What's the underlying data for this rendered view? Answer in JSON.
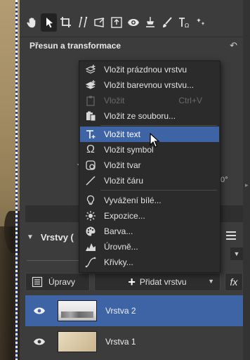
{
  "panel": {
    "section_title": "Přesun a transformace",
    "stub_a": "J",
    "stub_b": "0°"
  },
  "toolbar": {
    "tools": [
      "hand-icon",
      "pointer-icon",
      "crop-icon",
      "straighten-icon",
      "perspective-icon",
      "frame-icon",
      "eye-icon",
      "clone-icon",
      "brush-icon",
      "text-icon",
      "spot-icon"
    ]
  },
  "context_menu": {
    "items": [
      {
        "label": "Vložit prázdnou vrstvu",
        "icon": "new-layer-icon"
      },
      {
        "label": "Vložit barevnou vrstvu...",
        "icon": "color-layer-icon"
      },
      {
        "label": "Vložit",
        "icon": "paste-icon",
        "shortcut": "Ctrl+V",
        "disabled": true
      },
      {
        "label": "Vložit ze souboru...",
        "icon": "paste-file-icon"
      },
      {
        "label": "Vložit text",
        "icon": "text-icon",
        "highlighted": true
      },
      {
        "label": "Vložit symbol",
        "icon": "omega-icon"
      },
      {
        "label": "Vložit tvar",
        "icon": "shape-icon"
      },
      {
        "label": "Vložit čáru",
        "icon": "line-icon"
      },
      {
        "label": "Vyvážení bílé...",
        "icon": "bulb-icon"
      },
      {
        "label": "Expozice...",
        "icon": "sun-icon"
      },
      {
        "label": "Barva...",
        "icon": "palette-icon"
      },
      {
        "label": "Úrovně...",
        "icon": "levels-icon"
      },
      {
        "label": "Křivky...",
        "icon": "curves-icon"
      }
    ]
  },
  "layers": {
    "title": "Vrstvy (",
    "adjustments_label": "Úpravy",
    "add_layer_label": "Přidat vrstvu",
    "fx_label": "fx",
    "items": [
      {
        "name": "Vrstva 2",
        "selected": true
      },
      {
        "name": "Vrstva 1",
        "selected": false
      }
    ]
  },
  "colors": {
    "highlight": "#3e64a6",
    "menu_bg": "#2b2b2b",
    "panel_bg": "#3c3c3c"
  }
}
